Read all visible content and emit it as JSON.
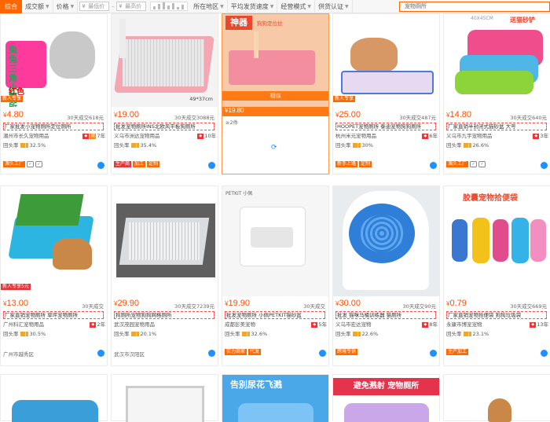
{
  "filterbar": {
    "first": "综合",
    "sorts": [
      "成交额",
      "价格"
    ],
    "price_from": "最低价",
    "price_to": "最高价",
    "region": "所在地区",
    "delivery": "平均发货速度",
    "mode": "经营模式",
    "cert": "供货认证",
    "search": "宠物厕所"
  },
  "cards": [
    {
      "img_label": "兔兔三角小厕所",
      "img_sub": "红色",
      "badge": "新人专享",
      "price": "4.80",
      "sold": "30天成交618元",
      "title": "厂家批发小宠物厕所定位厕所",
      "shop": "潮州市长久宠物用品",
      "years": "7年",
      "rate_label": "回头率",
      "rate": "32.5%",
      "tags": [
        "源头工厂"
      ]
    },
    {
      "img_label": "",
      "img_sub": "49*37cm",
      "badge": "",
      "price": "19.00",
      "sold": "30天成交3088元",
      "title": "批发宠物厕所INS北欧风平板狗厕所",
      "shop": "义乌市洲达宠物用品",
      "years": "10年",
      "rate_label": "回头率",
      "rate": "35.4%",
      "tags": [
        "生产商",
        "加工",
        "定制"
      ]
    },
    {
      "img_label": "神器",
      "img_sub": "狗狗定位拉",
      "badge": "",
      "price": "19.80",
      "sold": "≥2件",
      "title": "相似",
      "shop": "",
      "years": "",
      "rate_label": "",
      "rate": "",
      "tags": []
    },
    {
      "img_label": "",
      "img_sub": "",
      "badge": "新人专享",
      "price": "25.00",
      "sold": "30天成交487元",
      "title": "HOOPET宠物厕所 泰迪宠物狗狗厕所",
      "shop": "杭州米元宠物用品",
      "years": "6年",
      "rate_label": "回头率",
      "rate": "30%",
      "tags": [
        "新手上路",
        "定制"
      ]
    },
    {
      "img_label": "送猫砂铲",
      "img_sub": "40X45CM",
      "badge": "",
      "price": "14.80",
      "sold": "30天成交640元",
      "title": "厂家直销半封闭式猫砂盆 大号",
      "shop": "义乌市九宇宠物用品",
      "years": "3年",
      "rate_label": "回头率",
      "rate": "26.6%",
      "tags": [
        "源头工厂"
      ]
    },
    {
      "img_label": "",
      "img_sub": "",
      "badge": "新人专享5元",
      "price": "13.00",
      "sold": "30天成交",
      "title": "厂家直销宠物厕所 草坪宠物厕所",
      "shop": "广州科汇宠物用品",
      "years": "2年",
      "rate_label": "回头率",
      "rate": "30.5%",
      "tags": [
        "广州市越秀区"
      ]
    },
    {
      "img_label": "",
      "img_sub": "",
      "badge": "",
      "price": "29.90",
      "sold": "30天成交7239元",
      "title": "狗厕所宠物狗狗网格厕所",
      "shop": "武汉茂园宠物用品",
      "years": "",
      "rate_label": "回头率",
      "rate": "20.1%",
      "tags": [
        "武汉市汉阳区"
      ]
    },
    {
      "img_label": "PETKIT 小佩",
      "img_sub": "",
      "badge": "",
      "price": "19.90",
      "sold": "30天成交",
      "title": "批发宠物厕所 小佩PETKIT猫砂盆",
      "shop": "成都彭美宠物",
      "years": "5年",
      "rate_label": "回头率",
      "rate": "32.6%",
      "tags": [
        "实力商家",
        "代发"
      ]
    },
    {
      "img_label": "",
      "img_sub": "",
      "badge": "",
      "price": "30.00",
      "sold": "30天成交90元",
      "title": "批发 猫咪马桶训练器 猫厕所",
      "shop": "义乌市宏达宠物",
      "years": "8年",
      "rate_label": "回头率",
      "rate": "22.6%",
      "tags": [
        "跨境专供"
      ]
    },
    {
      "img_label": "胶囊宠物拾便袋",
      "img_sub": "",
      "badge": "",
      "price": "0.79",
      "sold": "30天成交669元",
      "title": "厂家直销宠物拾便袋 狗狗垃圾袋",
      "shop": "永康市博宠宠物",
      "years": "13年",
      "rate_label": "回头率",
      "rate": "23.1%",
      "tags": [
        "生产加工"
      ]
    }
  ],
  "row3": [
    {
      "img_label": ""
    },
    {
      "img_label": ""
    },
    {
      "img_label": "告别尿花飞溅"
    },
    {
      "img_label": "避免溅射 宠物厕所"
    },
    {
      "img_label": ""
    }
  ],
  "icons": {
    "aliwang": "aliwangwang-icon",
    "dropdown": "chevron-down-icon"
  },
  "colors": {
    "accent": "#ff6600",
    "price": "#ff5000",
    "highlight": "#ff9a4d",
    "wang": "#1e90ff"
  }
}
